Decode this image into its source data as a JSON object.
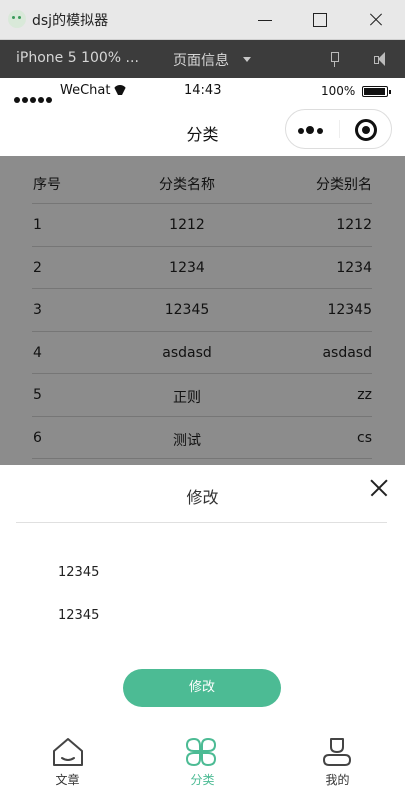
{
  "window": {
    "title": "dsj的模拟器"
  },
  "simulator": {
    "device": "iPhone 5 100% ...",
    "page_info": "页面信息"
  },
  "status_bar": {
    "carrier": "WeChat",
    "time": "14:43",
    "battery": "100%"
  },
  "nav": {
    "title": "分类"
  },
  "table": {
    "headers": [
      "序号",
      "分类名称",
      "分类别名"
    ],
    "rows": [
      [
        "1",
        "1212",
        "1212"
      ],
      [
        "2",
        "1234",
        "1234"
      ],
      [
        "3",
        "12345",
        "12345"
      ],
      [
        "4",
        "asdasd",
        "asdasd"
      ],
      [
        "5",
        "正则",
        "zz"
      ],
      [
        "6",
        "测试",
        "cs"
      ]
    ]
  },
  "sheet": {
    "title": "修改",
    "name_value": "12345",
    "alias_value": "12345",
    "submit_label": "修改"
  },
  "tabbar": {
    "items": [
      {
        "label": "文章",
        "icon": "home-icon"
      },
      {
        "label": "分类",
        "icon": "category-icon"
      },
      {
        "label": "我的",
        "icon": "user-icon"
      }
    ]
  },
  "colors": {
    "accent": "#4cbb94",
    "mask": "rgba(0,0,0,0.45)"
  }
}
